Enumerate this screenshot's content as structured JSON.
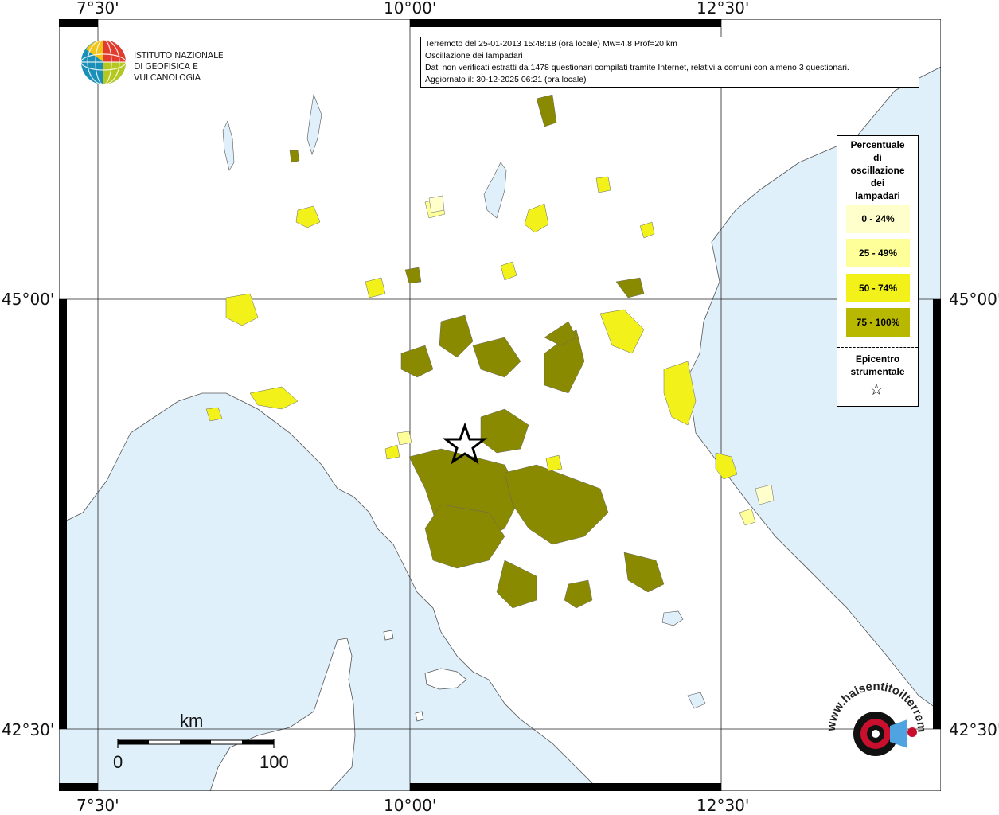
{
  "axes": {
    "lon_labels": [
      "7°30'",
      "10°00'",
      "12°30'"
    ],
    "lat_labels": [
      "45°00'",
      "42°30'"
    ]
  },
  "info": {
    "line1": "Terremoto del 25-01-2013 15:48:18 (ora locale) Mw=4.8 Prof=20 km",
    "line2": "Oscillazione dei lampadari",
    "line3": "Dati non verificati estratti da 1478 questionari compilati tramite Internet, relativi a comuni con almeno 3 questionari.",
    "line4": "Aggiornato il: 30-12-2025 06:21 (ora locale)"
  },
  "logo": {
    "line1": "ISTITUTO NAZIONALE",
    "line2": "DI GEOFISICA E VULCANOLOGIA"
  },
  "legend": {
    "title_lines": [
      "Percentuale",
      "di",
      "oscillazione",
      "dei",
      "lampadari"
    ],
    "classes": [
      {
        "label": "0 - 24%",
        "color": "#ffffcc"
      },
      {
        "label": "25 - 49%",
        "color": "#ffff99"
      },
      {
        "label": "50 - 74%",
        "color": "#f2f21a"
      },
      {
        "label": "75 - 100%",
        "color": "#b8b800"
      }
    ],
    "epicenter_lines": [
      "Epicentro",
      "strumentale"
    ],
    "epicenter_symbol": "☆"
  },
  "scale": {
    "unit": "km",
    "start": "0",
    "end": "100"
  },
  "site_logo": {
    "text": "www.haisentitoilterremoto.it"
  },
  "colors": {
    "sea": "#dff0fa",
    "land": "#ffffff",
    "class_0": "#ffffcc",
    "class_25": "#ffff99",
    "class_50": "#f2f21a",
    "class_75": "#8a8a00"
  }
}
